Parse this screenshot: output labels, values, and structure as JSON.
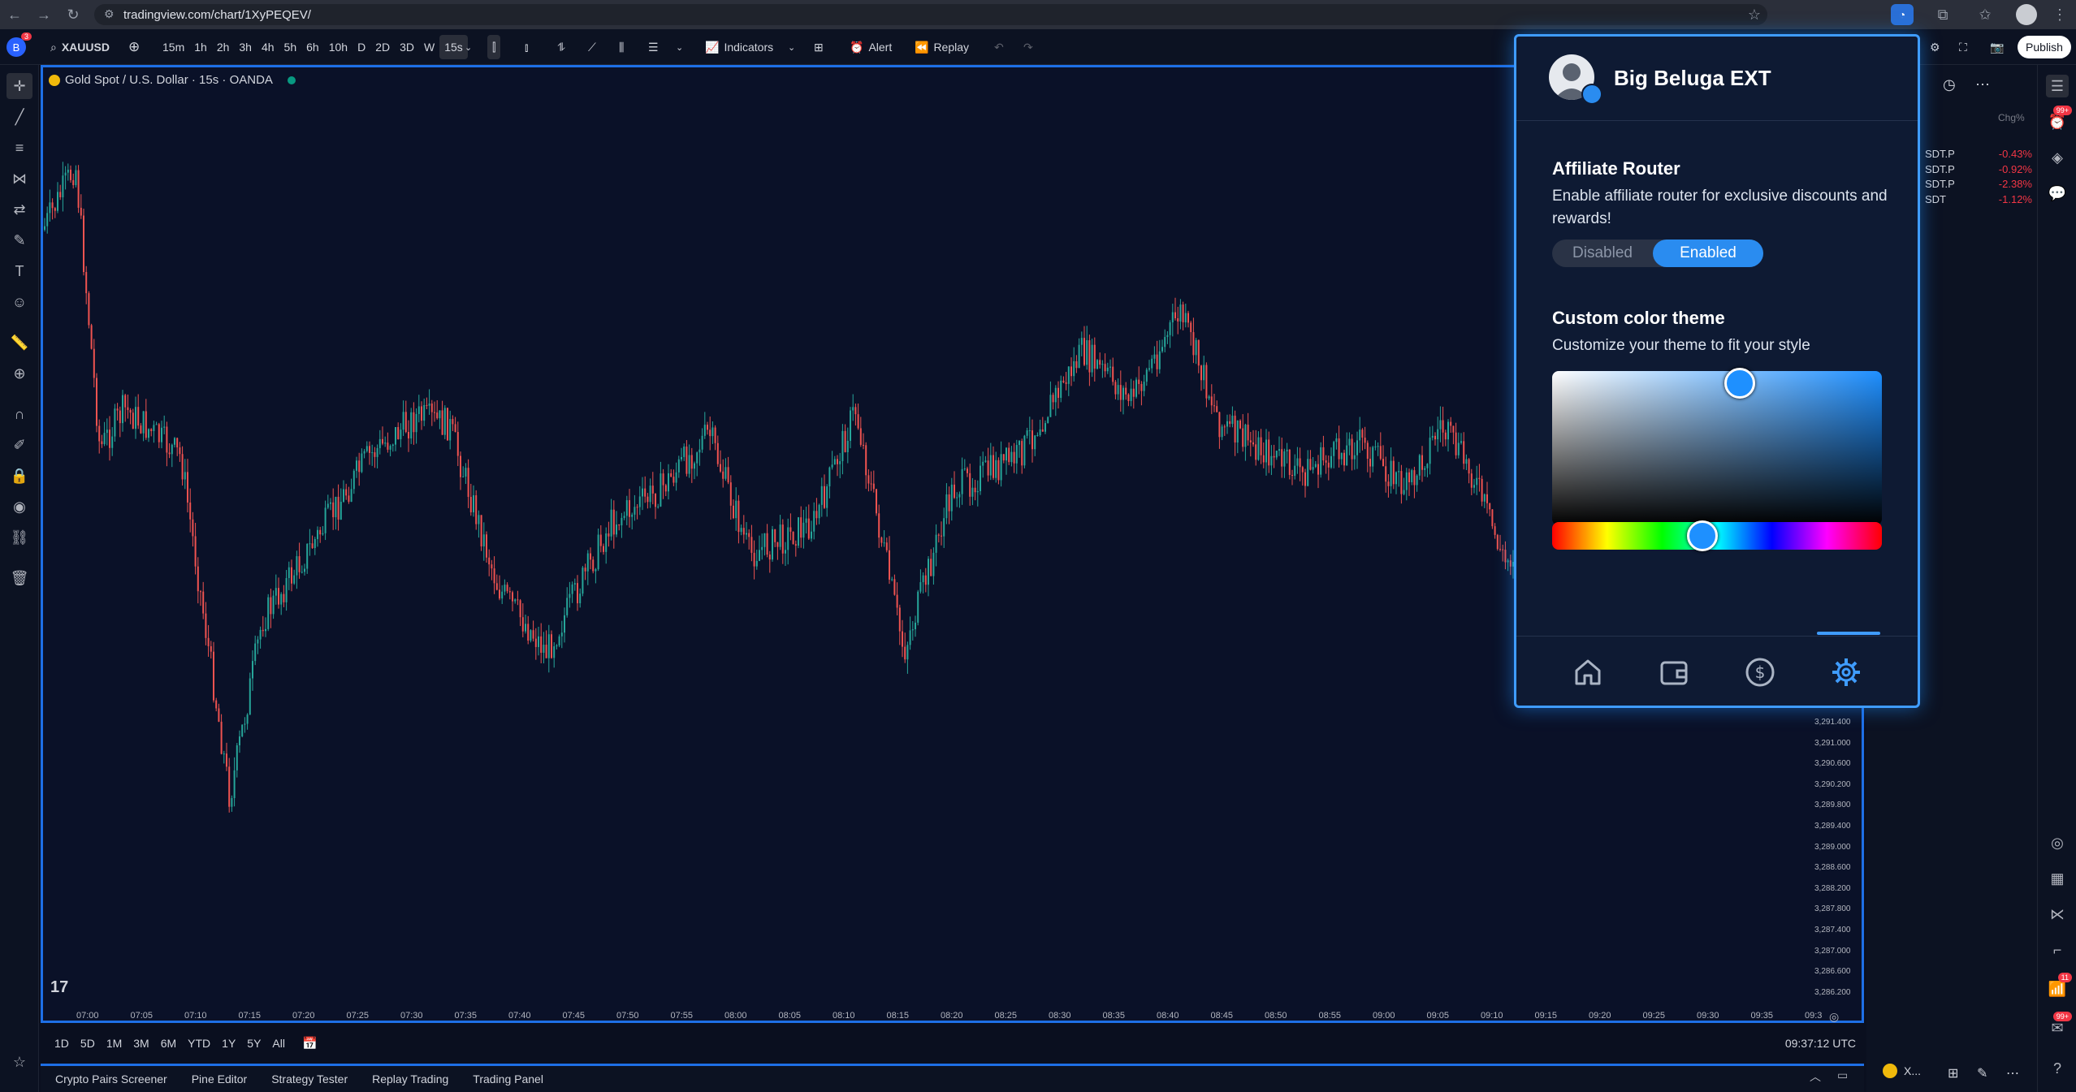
{
  "browser": {
    "url": "tradingview.com/chart/1XyPEQEV/",
    "icons": [
      "back-icon",
      "forward-icon",
      "reload-icon",
      "star-icon",
      "extension-icon",
      "profile-icon",
      "menu-icon"
    ]
  },
  "toolbar": {
    "symbol": "XAUUSD",
    "intervals": [
      "15m",
      "1h",
      "2h",
      "3h",
      "4h",
      "5h",
      "6h",
      "10h",
      "D",
      "2D",
      "3D",
      "W",
      "15s"
    ],
    "selected_interval": "15s",
    "indicators_label": "Indicators",
    "alert_label": "Alert",
    "replay_label": "Replay",
    "publish_label": "Publish",
    "notification_count": "3"
  },
  "chart": {
    "legend": "Gold Spot / U.S. Dollar · 15s · OANDA",
    "x_labels": [
      "07:00",
      "07:05",
      "07:10",
      "07:15",
      "07:20",
      "07:25",
      "07:30",
      "07:35",
      "07:40",
      "07:45",
      "07:50",
      "07:55",
      "08:00",
      "08:05",
      "08:10",
      "08:15",
      "08:20",
      "08:25",
      "08:30",
      "08:35",
      "08:40",
      "08:45",
      "08:50",
      "08:55",
      "09:00",
      "09:05",
      "09:10",
      "09:15",
      "09:20",
      "09:25",
      "09:30",
      "09:35",
      "09:3"
    ],
    "y_labels": [
      "3,291.400",
      "3,291.000",
      "3,290.600",
      "3,290.200",
      "3,289.800",
      "3,289.400",
      "3,289.000",
      "3,288.600",
      "3,288.200",
      "3,287.800",
      "3,287.400",
      "3,287.000",
      "3,286.600",
      "3,286.200"
    ],
    "up_color": "#26a69a",
    "down_color": "#ef5350"
  },
  "bottom": {
    "ranges": [
      "1D",
      "5D",
      "1M",
      "3M",
      "6M",
      "YTD",
      "1Y",
      "5Y",
      "All"
    ],
    "clock": "09:37:12 UTC",
    "panel_tabs": [
      "Crypto Pairs Screener",
      "Pine Editor",
      "Strategy Tester",
      "Replay Trading",
      "Trading Panel"
    ]
  },
  "watchlist": {
    "header": "Chg%",
    "rows": [
      {
        "symbol": "SDT.P",
        "chg": "-0.43%"
      },
      {
        "symbol": "SDT.P",
        "chg": "-0.92%"
      },
      {
        "symbol": "SDT.P",
        "chg": "-2.38%"
      },
      {
        "symbol": "SDT",
        "chg": "-1.12%"
      }
    ],
    "footer_symbol": "X..."
  },
  "right_badges": {
    "alerts": "99+",
    "notifications": "11",
    "messages": "99+"
  },
  "popup": {
    "title": "Big Beluga EXT",
    "affiliate_title": "Affiliate Router",
    "affiliate_desc": "Enable affiliate router for exclusive discounts and rewards!",
    "toggle_off": "Disabled",
    "toggle_on": "Enabled",
    "theme_title": "Custom color theme",
    "theme_desc": "Customize your theme to fit your style",
    "nav": [
      "home-icon",
      "wallet-icon",
      "dollar-icon",
      "settings-icon"
    ],
    "active_nav": "settings-icon",
    "accent": "#2a8cf0"
  }
}
